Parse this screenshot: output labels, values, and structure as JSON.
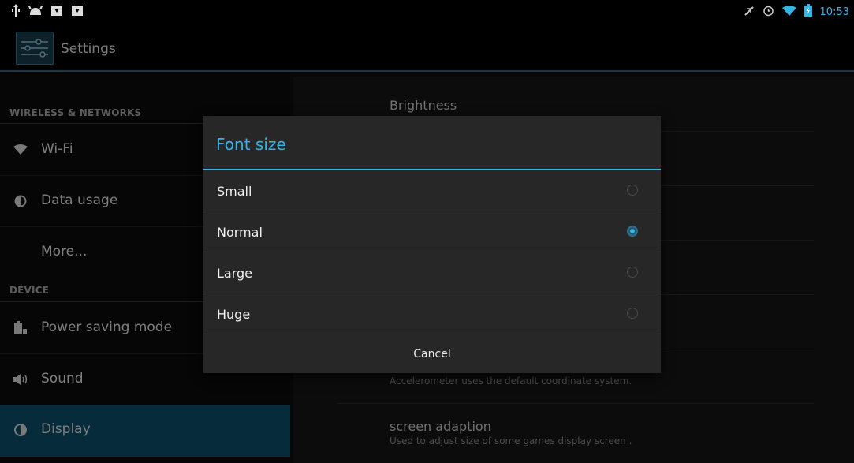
{
  "status_bar": {
    "left_icons": [
      "usb-icon",
      "android-debug-icon",
      "download-icon",
      "download-icon"
    ],
    "right_icons": [
      "mute-icon",
      "alarm-icon",
      "wifi-icon",
      "battery-charging-icon"
    ],
    "time": "10:53"
  },
  "action_bar": {
    "title": "Settings",
    "icon": "settings-sliders-icon"
  },
  "sidebar": {
    "wireless_header": "WIRELESS & NETWORKS",
    "device_header": "DEVICE",
    "items": [
      {
        "label": "Wi-Fi",
        "icon": "wifi-icon"
      },
      {
        "label": "Data usage",
        "icon": "data-usage-icon"
      },
      {
        "label": "More..."
      },
      {
        "label": "Power saving mode",
        "icon": "power-saving-icon"
      },
      {
        "label": "Sound",
        "icon": "sound-icon"
      },
      {
        "label": "Display",
        "icon": "display-icon",
        "selected": true
      }
    ]
  },
  "preferences": [
    {
      "title": "Brightness"
    },
    {
      "summary": "Accelerometer uses the default coordinate system."
    },
    {
      "title": "screen adaption",
      "summary": "Used to adjust size of some games display screen ."
    }
  ],
  "dialog": {
    "title": "Font size",
    "options": [
      {
        "label": "Small",
        "selected": false
      },
      {
        "label": "Normal",
        "selected": true
      },
      {
        "label": "Large",
        "selected": false
      },
      {
        "label": "Huge",
        "selected": false
      }
    ],
    "cancel_label": "Cancel"
  },
  "colors": {
    "accent": "#33b5e5",
    "selected_item_bg": "#0b4f6c",
    "dialog_bg": "#272727"
  }
}
